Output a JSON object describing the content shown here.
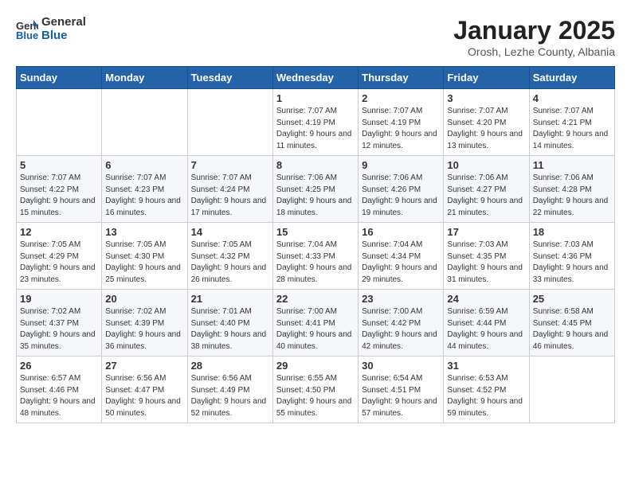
{
  "header": {
    "logo": {
      "general": "General",
      "blue": "Blue"
    },
    "title": "January 2025",
    "location": "Orosh, Lezhe County, Albania"
  },
  "weekdays": [
    "Sunday",
    "Monday",
    "Tuesday",
    "Wednesday",
    "Thursday",
    "Friday",
    "Saturday"
  ],
  "weeks": [
    [
      {
        "day": "",
        "sunrise": "",
        "sunset": "",
        "daylight": ""
      },
      {
        "day": "",
        "sunrise": "",
        "sunset": "",
        "daylight": ""
      },
      {
        "day": "",
        "sunrise": "",
        "sunset": "",
        "daylight": ""
      },
      {
        "day": "1",
        "sunrise": "Sunrise: 7:07 AM",
        "sunset": "Sunset: 4:19 PM",
        "daylight": "Daylight: 9 hours and 11 minutes."
      },
      {
        "day": "2",
        "sunrise": "Sunrise: 7:07 AM",
        "sunset": "Sunset: 4:19 PM",
        "daylight": "Daylight: 9 hours and 12 minutes."
      },
      {
        "day": "3",
        "sunrise": "Sunrise: 7:07 AM",
        "sunset": "Sunset: 4:20 PM",
        "daylight": "Daylight: 9 hours and 13 minutes."
      },
      {
        "day": "4",
        "sunrise": "Sunrise: 7:07 AM",
        "sunset": "Sunset: 4:21 PM",
        "daylight": "Daylight: 9 hours and 14 minutes."
      }
    ],
    [
      {
        "day": "5",
        "sunrise": "Sunrise: 7:07 AM",
        "sunset": "Sunset: 4:22 PM",
        "daylight": "Daylight: 9 hours and 15 minutes."
      },
      {
        "day": "6",
        "sunrise": "Sunrise: 7:07 AM",
        "sunset": "Sunset: 4:23 PM",
        "daylight": "Daylight: 9 hours and 16 minutes."
      },
      {
        "day": "7",
        "sunrise": "Sunrise: 7:07 AM",
        "sunset": "Sunset: 4:24 PM",
        "daylight": "Daylight: 9 hours and 17 minutes."
      },
      {
        "day": "8",
        "sunrise": "Sunrise: 7:06 AM",
        "sunset": "Sunset: 4:25 PM",
        "daylight": "Daylight: 9 hours and 18 minutes."
      },
      {
        "day": "9",
        "sunrise": "Sunrise: 7:06 AM",
        "sunset": "Sunset: 4:26 PM",
        "daylight": "Daylight: 9 hours and 19 minutes."
      },
      {
        "day": "10",
        "sunrise": "Sunrise: 7:06 AM",
        "sunset": "Sunset: 4:27 PM",
        "daylight": "Daylight: 9 hours and 21 minutes."
      },
      {
        "day": "11",
        "sunrise": "Sunrise: 7:06 AM",
        "sunset": "Sunset: 4:28 PM",
        "daylight": "Daylight: 9 hours and 22 minutes."
      }
    ],
    [
      {
        "day": "12",
        "sunrise": "Sunrise: 7:05 AM",
        "sunset": "Sunset: 4:29 PM",
        "daylight": "Daylight: 9 hours and 23 minutes."
      },
      {
        "day": "13",
        "sunrise": "Sunrise: 7:05 AM",
        "sunset": "Sunset: 4:30 PM",
        "daylight": "Daylight: 9 hours and 25 minutes."
      },
      {
        "day": "14",
        "sunrise": "Sunrise: 7:05 AM",
        "sunset": "Sunset: 4:32 PM",
        "daylight": "Daylight: 9 hours and 26 minutes."
      },
      {
        "day": "15",
        "sunrise": "Sunrise: 7:04 AM",
        "sunset": "Sunset: 4:33 PM",
        "daylight": "Daylight: 9 hours and 28 minutes."
      },
      {
        "day": "16",
        "sunrise": "Sunrise: 7:04 AM",
        "sunset": "Sunset: 4:34 PM",
        "daylight": "Daylight: 9 hours and 29 minutes."
      },
      {
        "day": "17",
        "sunrise": "Sunrise: 7:03 AM",
        "sunset": "Sunset: 4:35 PM",
        "daylight": "Daylight: 9 hours and 31 minutes."
      },
      {
        "day": "18",
        "sunrise": "Sunrise: 7:03 AM",
        "sunset": "Sunset: 4:36 PM",
        "daylight": "Daylight: 9 hours and 33 minutes."
      }
    ],
    [
      {
        "day": "19",
        "sunrise": "Sunrise: 7:02 AM",
        "sunset": "Sunset: 4:37 PM",
        "daylight": "Daylight: 9 hours and 35 minutes."
      },
      {
        "day": "20",
        "sunrise": "Sunrise: 7:02 AM",
        "sunset": "Sunset: 4:39 PM",
        "daylight": "Daylight: 9 hours and 36 minutes."
      },
      {
        "day": "21",
        "sunrise": "Sunrise: 7:01 AM",
        "sunset": "Sunset: 4:40 PM",
        "daylight": "Daylight: 9 hours and 38 minutes."
      },
      {
        "day": "22",
        "sunrise": "Sunrise: 7:00 AM",
        "sunset": "Sunset: 4:41 PM",
        "daylight": "Daylight: 9 hours and 40 minutes."
      },
      {
        "day": "23",
        "sunrise": "Sunrise: 7:00 AM",
        "sunset": "Sunset: 4:42 PM",
        "daylight": "Daylight: 9 hours and 42 minutes."
      },
      {
        "day": "24",
        "sunrise": "Sunrise: 6:59 AM",
        "sunset": "Sunset: 4:44 PM",
        "daylight": "Daylight: 9 hours and 44 minutes."
      },
      {
        "day": "25",
        "sunrise": "Sunrise: 6:58 AM",
        "sunset": "Sunset: 4:45 PM",
        "daylight": "Daylight: 9 hours and 46 minutes."
      }
    ],
    [
      {
        "day": "26",
        "sunrise": "Sunrise: 6:57 AM",
        "sunset": "Sunset: 4:46 PM",
        "daylight": "Daylight: 9 hours and 48 minutes."
      },
      {
        "day": "27",
        "sunrise": "Sunrise: 6:56 AM",
        "sunset": "Sunset: 4:47 PM",
        "daylight": "Daylight: 9 hours and 50 minutes."
      },
      {
        "day": "28",
        "sunrise": "Sunrise: 6:56 AM",
        "sunset": "Sunset: 4:49 PM",
        "daylight": "Daylight: 9 hours and 52 minutes."
      },
      {
        "day": "29",
        "sunrise": "Sunrise: 6:55 AM",
        "sunset": "Sunset: 4:50 PM",
        "daylight": "Daylight: 9 hours and 55 minutes."
      },
      {
        "day": "30",
        "sunrise": "Sunrise: 6:54 AM",
        "sunset": "Sunset: 4:51 PM",
        "daylight": "Daylight: 9 hours and 57 minutes."
      },
      {
        "day": "31",
        "sunrise": "Sunrise: 6:53 AM",
        "sunset": "Sunset: 4:52 PM",
        "daylight": "Daylight: 9 hours and 59 minutes."
      },
      {
        "day": "",
        "sunrise": "",
        "sunset": "",
        "daylight": ""
      }
    ]
  ]
}
